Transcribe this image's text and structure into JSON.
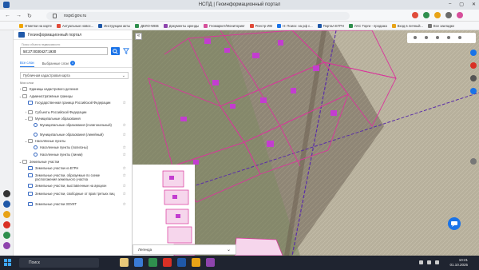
{
  "browser": {
    "window_title": "НСПД | Геоинформационный портал",
    "url": "nspd.gov.ru",
    "bookmarks": [
      "Отметки на карте",
      "Актуальные новос...",
      "Инструкции акты",
      "ДЕЛО-WEB",
      "Документы аренды",
      "Геомаркет/Мониторинг",
      "Реестр ИМ",
      "Н: Поиск: на рф с...",
      "Портал ЕГРН",
      "ЛАС Торги - продажа",
      "Вход в личный...",
      "Все закладки"
    ]
  },
  "panel": {
    "title": "Геоинформационный портал",
    "search_label": "Поиск объекта недвижимости",
    "search_value": "50:27:0030427:1930",
    "tabs": [
      {
        "label": "Все слои"
      },
      {
        "label": "Выбранные слои",
        "count": "3"
      }
    ],
    "basemap_select": "Публичная кадастровая карта",
    "subtitle": "Мои слои",
    "tree": [
      {
        "label": "Единицы кадастрового деления",
        "level": 0,
        "toggle": "›",
        "icon": "folder"
      },
      {
        "label": "Административные границы",
        "level": 0,
        "toggle": "⌄",
        "icon": "folder"
      },
      {
        "label": "Государственная граница Российской Федерации",
        "level": 1,
        "toggle": "",
        "icon": "layer",
        "star": "☆"
      },
      {
        "label": "Субъекты Российской Федерации",
        "level": 1,
        "toggle": "›",
        "icon": "folder"
      },
      {
        "label": "Муниципальные образования",
        "level": 1,
        "toggle": "⌄",
        "icon": "folder"
      },
      {
        "label": "Муниципальные образования (полигональный)",
        "level": 2,
        "toggle": "",
        "icon": "circ",
        "star": "☆"
      },
      {
        "label": "Муниципальные образования (линейный)",
        "level": 2,
        "toggle": "",
        "icon": "circ",
        "star": "☆"
      },
      {
        "label": "Населённые пункты",
        "level": 1,
        "toggle": "⌄",
        "icon": "folder"
      },
      {
        "label": "Населенные пункты (полигоны)",
        "level": 2,
        "toggle": "",
        "icon": "circ",
        "star": "☆"
      },
      {
        "label": "Населенные пункты (линии)",
        "level": 2,
        "toggle": "",
        "icon": "circ",
        "star": "☆"
      },
      {
        "label": "Земельные участки",
        "level": 0,
        "toggle": "⌄",
        "icon": "folder"
      },
      {
        "label": "Земельные участки из ЕГРН",
        "level": 1,
        "toggle": "",
        "icon": "layer",
        "star": "☆"
      },
      {
        "label": "Земельные участки, образуемые по схеме расположения земельного участка",
        "level": 1,
        "toggle": "",
        "icon": "layer",
        "star": "☆"
      },
      {
        "label": "Земельные участки, выставленные на аукцион",
        "level": 1,
        "toggle": "",
        "icon": "layer",
        "star": "☆"
      },
      {
        "label": "Земельные участки, свободные от прав третьих лиц",
        "level": 1,
        "toggle": "",
        "icon": "layer",
        "star": "☆"
      },
      {
        "label": "Земельные участки ЗОУИТ",
        "level": 1,
        "toggle": "",
        "icon": "layer",
        "star": "☆"
      }
    ]
  },
  "map": {
    "legend_label": "Легенда",
    "collapse_label": "«"
  },
  "taskbar": {
    "search_placeholder": "Поиск",
    "time": "10:21",
    "date": "01.10.2025"
  },
  "colors": {
    "accent": "#1a73e8",
    "parcel_stroke": "#d9369b",
    "building_fill": "#c33dd0"
  }
}
